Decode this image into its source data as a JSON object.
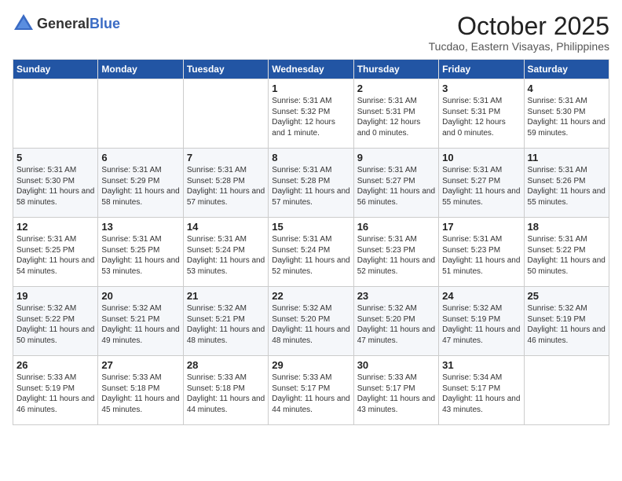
{
  "header": {
    "logo_general": "General",
    "logo_blue": "Blue",
    "month": "October 2025",
    "location": "Tucdao, Eastern Visayas, Philippines"
  },
  "weekdays": [
    "Sunday",
    "Monday",
    "Tuesday",
    "Wednesday",
    "Thursday",
    "Friday",
    "Saturday"
  ],
  "weeks": [
    [
      {
        "day": "",
        "sunrise": "",
        "sunset": "",
        "daylight": ""
      },
      {
        "day": "",
        "sunrise": "",
        "sunset": "",
        "daylight": ""
      },
      {
        "day": "",
        "sunrise": "",
        "sunset": "",
        "daylight": ""
      },
      {
        "day": "1",
        "sunrise": "Sunrise: 5:31 AM",
        "sunset": "Sunset: 5:32 PM",
        "daylight": "Daylight: 12 hours and 1 minute."
      },
      {
        "day": "2",
        "sunrise": "Sunrise: 5:31 AM",
        "sunset": "Sunset: 5:31 PM",
        "daylight": "Daylight: 12 hours and 0 minutes."
      },
      {
        "day": "3",
        "sunrise": "Sunrise: 5:31 AM",
        "sunset": "Sunset: 5:31 PM",
        "daylight": "Daylight: 12 hours and 0 minutes."
      },
      {
        "day": "4",
        "sunrise": "Sunrise: 5:31 AM",
        "sunset": "Sunset: 5:30 PM",
        "daylight": "Daylight: 11 hours and 59 minutes."
      }
    ],
    [
      {
        "day": "5",
        "sunrise": "Sunrise: 5:31 AM",
        "sunset": "Sunset: 5:30 PM",
        "daylight": "Daylight: 11 hours and 58 minutes."
      },
      {
        "day": "6",
        "sunrise": "Sunrise: 5:31 AM",
        "sunset": "Sunset: 5:29 PM",
        "daylight": "Daylight: 11 hours and 58 minutes."
      },
      {
        "day": "7",
        "sunrise": "Sunrise: 5:31 AM",
        "sunset": "Sunset: 5:28 PM",
        "daylight": "Daylight: 11 hours and 57 minutes."
      },
      {
        "day": "8",
        "sunrise": "Sunrise: 5:31 AM",
        "sunset": "Sunset: 5:28 PM",
        "daylight": "Daylight: 11 hours and 57 minutes."
      },
      {
        "day": "9",
        "sunrise": "Sunrise: 5:31 AM",
        "sunset": "Sunset: 5:27 PM",
        "daylight": "Daylight: 11 hours and 56 minutes."
      },
      {
        "day": "10",
        "sunrise": "Sunrise: 5:31 AM",
        "sunset": "Sunset: 5:27 PM",
        "daylight": "Daylight: 11 hours and 55 minutes."
      },
      {
        "day": "11",
        "sunrise": "Sunrise: 5:31 AM",
        "sunset": "Sunset: 5:26 PM",
        "daylight": "Daylight: 11 hours and 55 minutes."
      }
    ],
    [
      {
        "day": "12",
        "sunrise": "Sunrise: 5:31 AM",
        "sunset": "Sunset: 5:25 PM",
        "daylight": "Daylight: 11 hours and 54 minutes."
      },
      {
        "day": "13",
        "sunrise": "Sunrise: 5:31 AM",
        "sunset": "Sunset: 5:25 PM",
        "daylight": "Daylight: 11 hours and 53 minutes."
      },
      {
        "day": "14",
        "sunrise": "Sunrise: 5:31 AM",
        "sunset": "Sunset: 5:24 PM",
        "daylight": "Daylight: 11 hours and 53 minutes."
      },
      {
        "day": "15",
        "sunrise": "Sunrise: 5:31 AM",
        "sunset": "Sunset: 5:24 PM",
        "daylight": "Daylight: 11 hours and 52 minutes."
      },
      {
        "day": "16",
        "sunrise": "Sunrise: 5:31 AM",
        "sunset": "Sunset: 5:23 PM",
        "daylight": "Daylight: 11 hours and 52 minutes."
      },
      {
        "day": "17",
        "sunrise": "Sunrise: 5:31 AM",
        "sunset": "Sunset: 5:23 PM",
        "daylight": "Daylight: 11 hours and 51 minutes."
      },
      {
        "day": "18",
        "sunrise": "Sunrise: 5:31 AM",
        "sunset": "Sunset: 5:22 PM",
        "daylight": "Daylight: 11 hours and 50 minutes."
      }
    ],
    [
      {
        "day": "19",
        "sunrise": "Sunrise: 5:32 AM",
        "sunset": "Sunset: 5:22 PM",
        "daylight": "Daylight: 11 hours and 50 minutes."
      },
      {
        "day": "20",
        "sunrise": "Sunrise: 5:32 AM",
        "sunset": "Sunset: 5:21 PM",
        "daylight": "Daylight: 11 hours and 49 minutes."
      },
      {
        "day": "21",
        "sunrise": "Sunrise: 5:32 AM",
        "sunset": "Sunset: 5:21 PM",
        "daylight": "Daylight: 11 hours and 48 minutes."
      },
      {
        "day": "22",
        "sunrise": "Sunrise: 5:32 AM",
        "sunset": "Sunset: 5:20 PM",
        "daylight": "Daylight: 11 hours and 48 minutes."
      },
      {
        "day": "23",
        "sunrise": "Sunrise: 5:32 AM",
        "sunset": "Sunset: 5:20 PM",
        "daylight": "Daylight: 11 hours and 47 minutes."
      },
      {
        "day": "24",
        "sunrise": "Sunrise: 5:32 AM",
        "sunset": "Sunset: 5:19 PM",
        "daylight": "Daylight: 11 hours and 47 minutes."
      },
      {
        "day": "25",
        "sunrise": "Sunrise: 5:32 AM",
        "sunset": "Sunset: 5:19 PM",
        "daylight": "Daylight: 11 hours and 46 minutes."
      }
    ],
    [
      {
        "day": "26",
        "sunrise": "Sunrise: 5:33 AM",
        "sunset": "Sunset: 5:19 PM",
        "daylight": "Daylight: 11 hours and 46 minutes."
      },
      {
        "day": "27",
        "sunrise": "Sunrise: 5:33 AM",
        "sunset": "Sunset: 5:18 PM",
        "daylight": "Daylight: 11 hours and 45 minutes."
      },
      {
        "day": "28",
        "sunrise": "Sunrise: 5:33 AM",
        "sunset": "Sunset: 5:18 PM",
        "daylight": "Daylight: 11 hours and 44 minutes."
      },
      {
        "day": "29",
        "sunrise": "Sunrise: 5:33 AM",
        "sunset": "Sunset: 5:17 PM",
        "daylight": "Daylight: 11 hours and 44 minutes."
      },
      {
        "day": "30",
        "sunrise": "Sunrise: 5:33 AM",
        "sunset": "Sunset: 5:17 PM",
        "daylight": "Daylight: 11 hours and 43 minutes."
      },
      {
        "day": "31",
        "sunrise": "Sunrise: 5:34 AM",
        "sunset": "Sunset: 5:17 PM",
        "daylight": "Daylight: 11 hours and 43 minutes."
      },
      {
        "day": "",
        "sunrise": "",
        "sunset": "",
        "daylight": ""
      }
    ]
  ]
}
